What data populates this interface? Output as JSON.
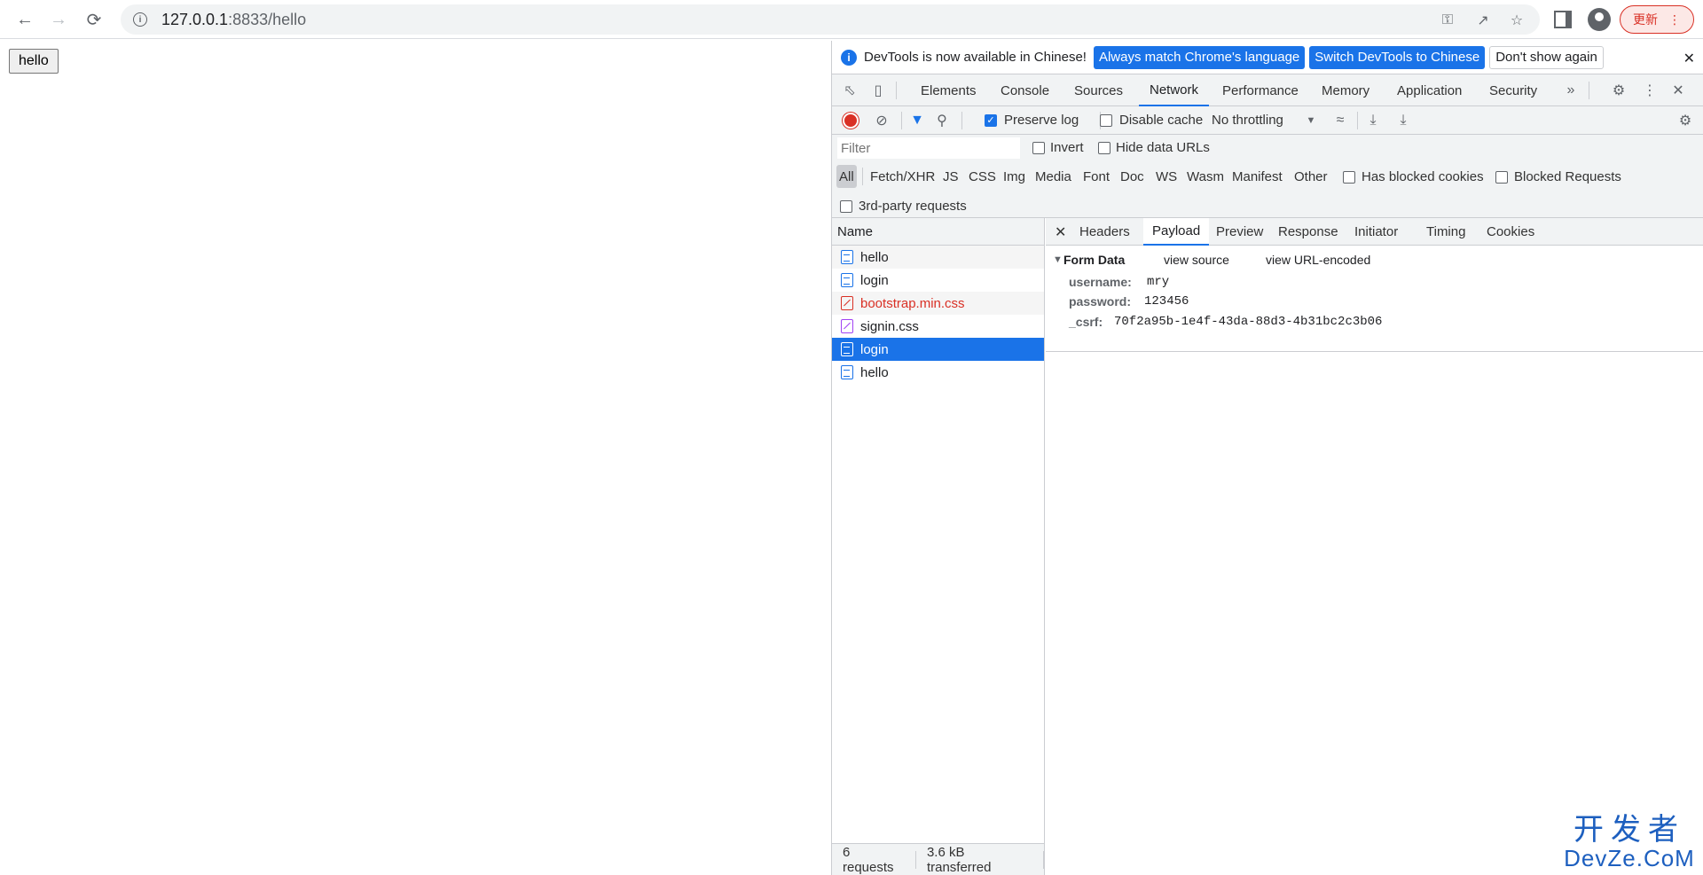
{
  "browser": {
    "url_host": "127.0.0.1",
    "url_rest": ":8833/hello",
    "update_label": "更新"
  },
  "page": {
    "button_label": "hello"
  },
  "devtools": {
    "infobar": {
      "message": "DevTools is now available in Chinese!",
      "btn_match": "Always match Chrome's language",
      "btn_switch": "Switch DevTools to Chinese",
      "btn_dismiss": "Don't show again"
    },
    "tabs": [
      "Elements",
      "Console",
      "Sources",
      "Network",
      "Performance",
      "Memory",
      "Application",
      "Security"
    ],
    "toolbar": {
      "preserve_log": "Preserve log",
      "disable_cache": "Disable cache",
      "throttling": "No throttling"
    },
    "filter": {
      "placeholder": "Filter",
      "invert": "Invert",
      "hide_data_urls": "Hide data URLs",
      "types": [
        "All",
        "Fetch/XHR",
        "JS",
        "CSS",
        "Img",
        "Media",
        "Font",
        "Doc",
        "WS",
        "Wasm",
        "Manifest",
        "Other"
      ],
      "has_blocked_cookies": "Has blocked cookies",
      "blocked_requests": "Blocked Requests",
      "third_party": "3rd-party requests"
    },
    "requests": {
      "header": "Name",
      "rows": [
        {
          "name": "hello",
          "type": "doc"
        },
        {
          "name": "login",
          "type": "doc"
        },
        {
          "name": "bootstrap.min.css",
          "type": "css-error"
        },
        {
          "name": "signin.css",
          "type": "css"
        },
        {
          "name": "login",
          "type": "doc",
          "selected": true
        },
        {
          "name": "hello",
          "type": "doc"
        }
      ],
      "summary_count": "6 requests",
      "summary_size": "3.6 kB transferred"
    },
    "detail": {
      "tabs": [
        "Headers",
        "Payload",
        "Preview",
        "Response",
        "Initiator",
        "Timing",
        "Cookies"
      ],
      "active_tab": "Payload",
      "section_title": "Form Data",
      "view_source": "view source",
      "view_url_encoded": "view URL-encoded",
      "fields": [
        {
          "key": "username:",
          "value": "mry"
        },
        {
          "key": "password:",
          "value": "123456"
        },
        {
          "key": "_csrf:",
          "value": "70f2a95b-1e4f-43da-88d3-4b31bc2c3b06"
        }
      ]
    }
  },
  "watermark": {
    "line1": "开发者",
    "line2": "DevZe.CoM"
  }
}
